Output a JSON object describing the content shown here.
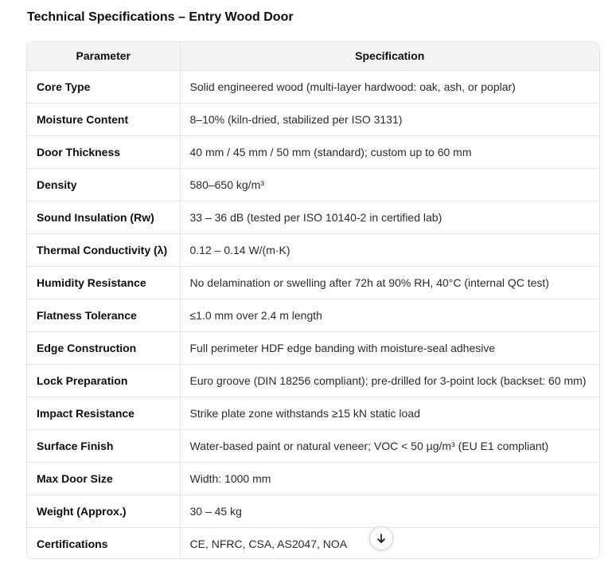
{
  "title": "Technical Specifications – Entry Wood Door",
  "table": {
    "headers": {
      "parameter": "Parameter",
      "specification": "Specification"
    },
    "rows": [
      {
        "parameter": "Core Type",
        "specification": "Solid engineered wood (multi-layer hardwood: oak, ash, or poplar)"
      },
      {
        "parameter": "Moisture Content",
        "specification": "8–10% (kiln-dried, stabilized per ISO 3131)"
      },
      {
        "parameter": "Door Thickness",
        "specification": "40 mm / 45 mm / 50 mm (standard); custom up to 60 mm"
      },
      {
        "parameter": "Density",
        "specification": "580–650 kg/m³"
      },
      {
        "parameter": "Sound Insulation (Rw)",
        "specification": "33 – 36 dB (tested per ISO 10140-2 in certified lab)"
      },
      {
        "parameter": "Thermal Conductivity (λ)",
        "specification": "0.12 – 0.14 W/(m·K)"
      },
      {
        "parameter": "Humidity Resistance",
        "specification": "No delamination or swelling after 72h at 90% RH, 40°C (internal QC test)"
      },
      {
        "parameter": "Flatness Tolerance",
        "specification": "≤1.0 mm over 2.4 m length"
      },
      {
        "parameter": "Edge Construction",
        "specification": "Full perimeter HDF edge banding with moisture-seal adhesive"
      },
      {
        "parameter": "Lock Preparation",
        "specification": "Euro groove (DIN 18256 compliant); pre-drilled for 3-point lock (backset: 60 mm)"
      },
      {
        "parameter": "Impact Resistance",
        "specification": "Strike plate zone withstands ≥15 kN static load"
      },
      {
        "parameter": "Surface Finish",
        "specification": "Water-based paint or natural veneer; VOC < 50 µg/m³ (EU E1 compliant)"
      },
      {
        "parameter": "Max Door Size",
        "specification": "Width: 1000 mm"
      },
      {
        "parameter": "Weight (Approx.)",
        "specification": "30 – 45 kg"
      },
      {
        "parameter": "Certifications",
        "specification": "CE, NFRC, CSA, AS2047, NOA"
      }
    ]
  },
  "scroll_button": {
    "icon": "arrow-down-icon"
  }
}
